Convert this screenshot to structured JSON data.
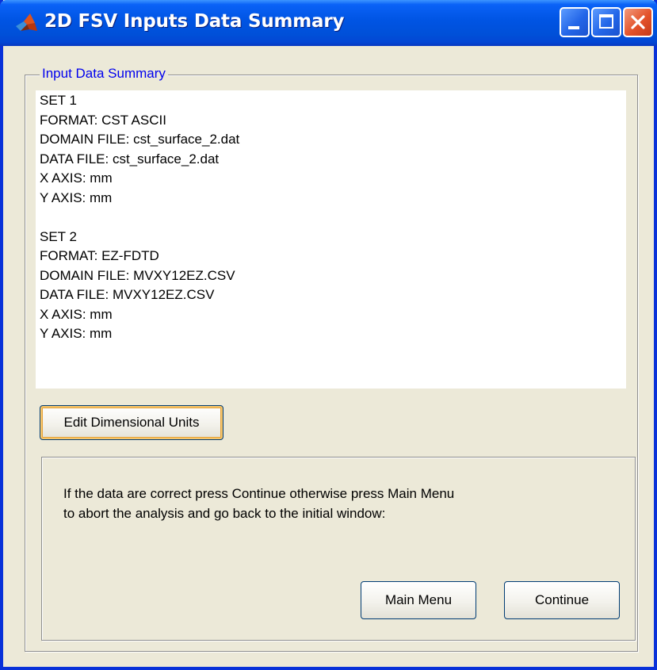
{
  "window": {
    "title": "2D FSV Inputs Data Summary",
    "title_bar_color": "#0054e3",
    "close_button_color": "#e3522a"
  },
  "title_bar_buttons": {
    "minimize_icon": "minimize-icon",
    "maximize_icon": "maximize-icon",
    "close_icon": "close-icon"
  },
  "summary_group": {
    "legend": "Input Data Summary",
    "legend_color": "#0000ee",
    "lines": [
      "SET 1",
      "FORMAT: CST ASCII",
      "DOMAIN FILE: cst_surface_2.dat",
      "DATA FILE: cst_surface_2.dat",
      "X AXIS: mm",
      "Y AXIS: mm",
      "",
      "SET 2",
      "FORMAT: EZ-FDTD",
      "DOMAIN FILE: MVXY12EZ.CSV",
      "DATA FILE: MVXY12EZ.CSV",
      "X AXIS: mm",
      "Y AXIS: mm"
    ],
    "edit_units_label": "Edit Dimensional Units"
  },
  "confirm_panel": {
    "message_lines": [
      "If the data are correct press Continue otherwise press Main Menu",
      "to abort the analysis and go back to the initial window:"
    ],
    "main_menu_label": "Main Menu",
    "continue_label": "Continue"
  }
}
